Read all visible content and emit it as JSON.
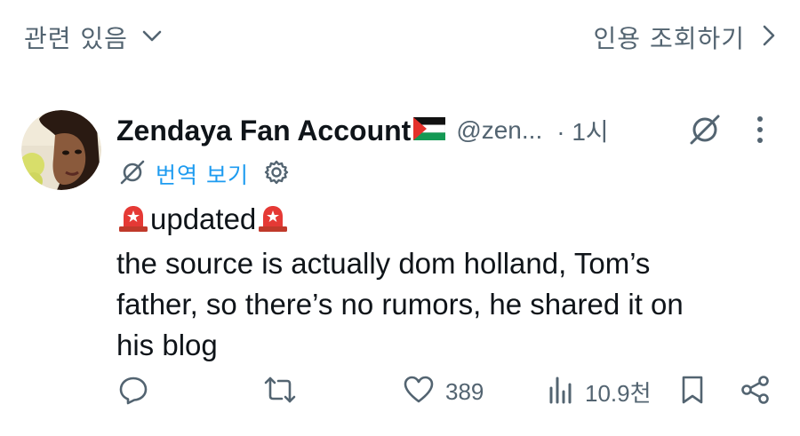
{
  "topbar": {
    "sort_label": "관련 있음",
    "quotes_label": "인용 조회하기"
  },
  "post": {
    "display_name": "Zendaya Fan Account",
    "handle": "@zen...",
    "time": "· 1시",
    "translate_label": "번역 보기",
    "body": {
      "line1": "updated",
      "line2": "the source is actually dom holland, Tom’s",
      "line3": "father, so there’s no rumors, he shared it on",
      "line4": "his blog"
    },
    "actions": {
      "likes": "389",
      "views": "10.9천"
    }
  },
  "colors": {
    "text_primary": "#0f1419",
    "text_secondary": "#536471",
    "accent_blue": "#1d9bf0"
  },
  "icons": [
    "chevron-down-icon",
    "chevron-right-icon",
    "avatar",
    "palestine-flag-icon",
    "grok-icon",
    "more-icon",
    "translate-icon",
    "gear-icon",
    "siren-icon",
    "reply-icon",
    "repost-icon",
    "like-icon",
    "views-icon",
    "bookmark-icon",
    "share-icon"
  ]
}
